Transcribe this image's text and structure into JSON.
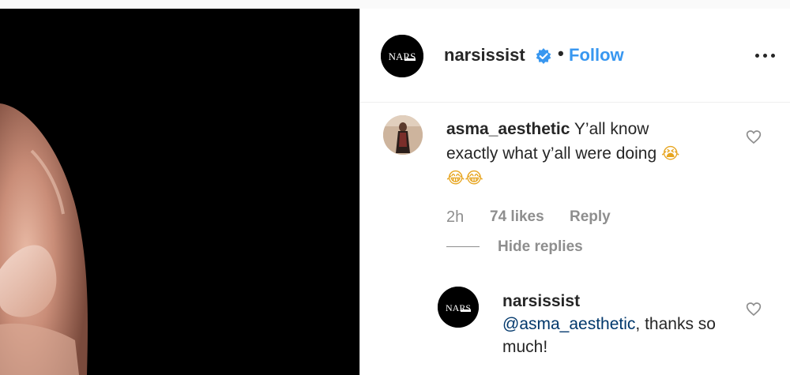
{
  "post_author": {
    "username": "narsissist",
    "avatar_text": "NARS",
    "follow_label": "Follow",
    "separator": "•"
  },
  "icons": {
    "verified": "verified-badge-icon",
    "more": "more-options-icon",
    "like": "heart-outline-icon"
  },
  "comment": {
    "username": "asma_aesthetic",
    "text": "Y’all know exactly what y’all were doing",
    "emoji_cry": "😭",
    "emoji_laugh": "😂😂",
    "time": "2h",
    "likes": "74 likes",
    "reply_label": "Reply",
    "hide_replies_label": "Hide replies"
  },
  "reply": {
    "username": "narsissist",
    "mention": "@asma_aesthetic",
    "text": ", thanks so much!"
  },
  "colors": {
    "accent": "#3897f0",
    "mention": "#00376b",
    "muted": "#8e8e8e"
  }
}
